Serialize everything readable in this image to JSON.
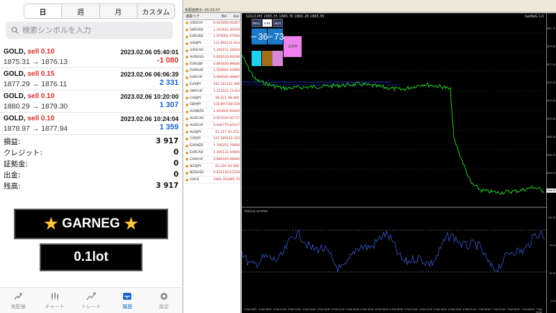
{
  "phone": {
    "tabs": [
      {
        "label": "日",
        "active": true
      },
      {
        "label": "週",
        "active": false
      },
      {
        "label": "月",
        "active": false
      },
      {
        "label": "カスタム",
        "active": false
      }
    ],
    "search_placeholder": "検索シンボルを入力",
    "trades": [
      {
        "symbol": "GOLD,",
        "side": "sell 0.10",
        "time": "2023.02.06 05:40:01",
        "prices": "1875.31 → 1876.13",
        "pl": "-1 080",
        "pl_sign": "neg"
      },
      {
        "symbol": "GOLD,",
        "side": "sell 0.15",
        "time": "2023.02.06 06:06:39",
        "prices": "1877.29 → 1876.11",
        "pl": "2 331",
        "pl_sign": "pos"
      },
      {
        "symbol": "GOLD,",
        "side": "sell 0.10",
        "time": "2023.02.06 10:20:00",
        "prices": "1880.29 → 1879.30",
        "pl": "1 307",
        "pl_sign": "pos"
      },
      {
        "symbol": "GOLD,",
        "side": "sell 0.10",
        "time": "2023.02.06 10:24:04",
        "prices": "1878.97 → 1877.94",
        "pl": "1 359",
        "pl_sign": "pos"
      }
    ],
    "summary": [
      {
        "label": "損益:",
        "value": "3 917"
      },
      {
        "label": "クレジット:",
        "value": "0"
      },
      {
        "label": "証拠金:",
        "value": "0"
      },
      {
        "label": "出金:",
        "value": "0"
      },
      {
        "label": "残高:",
        "value": "3 917"
      }
    ],
    "banner_title": "GARNEG",
    "banner_lot": "0.1lot",
    "nav": [
      {
        "label": "気配値",
        "icon": "quotes-icon",
        "active": false
      },
      {
        "label": "チャート",
        "icon": "chart-icon",
        "active": false
      },
      {
        "label": "トレード",
        "icon": "trade-icon",
        "active": false
      },
      {
        "label": "履歴",
        "icon": "history-icon",
        "active": true
      },
      {
        "label": "設定",
        "icon": "settings-icon",
        "active": false
      }
    ],
    "colors": {
      "sell": "#d0302c",
      "profit": "#1a60c8",
      "loss": "#d0302c",
      "active_nav": "#1a66c4"
    }
  },
  "desktop": {
    "market_watch": {
      "title": "気配値表示: 05:03:57",
      "headers": {
        "symbol": "通貨ペア",
        "bid": "Bid",
        "ask": "Ask"
      },
      "rows": [
        {
          "symbol": "USDCHF",
          "bid": "0.92445",
          "ask": "0.92467"
        },
        {
          "symbol": "GBPUSD",
          "bid": "1.20416",
          "ask": "1.20439"
        },
        {
          "symbol": "EURUSD",
          "bid": "1.07900",
          "ask": "1.07926"
        },
        {
          "symbol": "USDJPY",
          "bid": "131.892",
          "ask": "131.914"
        },
        {
          "symbol": "USDCAD",
          "bid": "1.34015",
          "ask": "1.34044"
        },
        {
          "symbol": "AUDUSD",
          "bid": "0.69162",
          "ask": "0.69189"
        },
        {
          "symbol": "EURGBP",
          "bid": "0.89582",
          "ask": "0.89606"
        },
        {
          "symbol": "EURAUD",
          "bid": "1.55960",
          "ask": "1.55996"
        },
        {
          "symbol": "EURCHF",
          "bid": "0.99956",
          "ask": "0.99987"
        },
        {
          "symbol": "EURJPY",
          "bid": "142.341",
          "ask": "142.366"
        },
        {
          "symbol": "GBPCHF",
          "bid": "1.11352",
          "ask": "1.11410"
        },
        {
          "symbol": "CADJPY",
          "bid": "98.421",
          "ask": "98.460"
        },
        {
          "symbol": "GBPJPY",
          "bid": "158.897",
          "ask": "158.939"
        },
        {
          "symbol": "AUDNZD",
          "bid": "1.09360",
          "ask": "1.09420"
        },
        {
          "symbol": "AUDCAD",
          "bid": "0.92702",
          "ask": "0.92737"
        },
        {
          "symbol": "AUDCHF",
          "bid": "0.64077",
          "ask": "0.64107"
        },
        {
          "symbol": "AUDJPY",
          "bid": "91.217",
          "ask": "91.252"
        },
        {
          "symbol": "CHFJPY",
          "bid": "142.389",
          "ask": "142.433"
        },
        {
          "symbol": "EURNZD",
          "bid": "1.70625",
          "ask": "1.70694"
        },
        {
          "symbol": "EURCAD",
          "bid": "1.44613",
          "ask": "1.44666"
        },
        {
          "symbol": "CADCHF",
          "bid": "0.68932",
          "ask": "0.68966"
        },
        {
          "symbol": "NZDJPY",
          "bid": "83.420",
          "ask": "83.466"
        },
        {
          "symbol": "NZDUSD",
          "bid": "0.63214",
          "ask": "0.63239"
        },
        {
          "symbol": "GOLD",
          "bid": "1865.35",
          "ask": "1865.70"
        }
      ]
    },
    "chart": {
      "title": "GOLD,M5 1865.35 1865.70 1865.28 1865.35",
      "right_label": "GarNeG 1.0",
      "one_click": {
        "sell": "SELL",
        "buy": "BUY",
        "lot": "0.01",
        "sell_big": "36",
        "buy_big": "73",
        "sell_small": "1865",
        "buy_small": "1865",
        "pink_label": "全決済"
      },
      "price_labels": [
        "1881.70",
        "1879.50",
        "1877.25",
        "1875.05",
        "1872.80",
        "1870.60",
        "1868.35",
        "1866.15",
        "1863.90",
        "1861.70"
      ],
      "current_price": "1865.35",
      "osc_title": "RSI(14) 44.0700",
      "osc_labels": [
        "100.00",
        "70.00",
        "30.00",
        "0.00"
      ],
      "x_labels": [
        "3 Feb 2023",
        "3 Feb 08:00",
        "3 Feb 10:40",
        "3 Feb 13:20",
        "3 Feb 16:00",
        "3 Feb 18:40",
        "3 Feb 21:20",
        "6 Feb 00:00",
        "6 Feb 02:40",
        "6 Feb 05:20",
        "6 Feb 08:00",
        "6 Feb 10:40",
        "6 Feb 13:20",
        "6 Feb 16:00",
        "6 Feb 18:40",
        "6 Feb 21:20",
        "7 Feb 00:00",
        "7 Feb 02:40",
        "7 Feb 05:20",
        "7 Feb 08:00",
        "7 Feb 10:40"
      ],
      "colors": {
        "price_line": "#22cc22",
        "blue_line": "#2a4cff",
        "osc_line": "#3a5bd0",
        "bg": "#000000"
      }
    }
  }
}
